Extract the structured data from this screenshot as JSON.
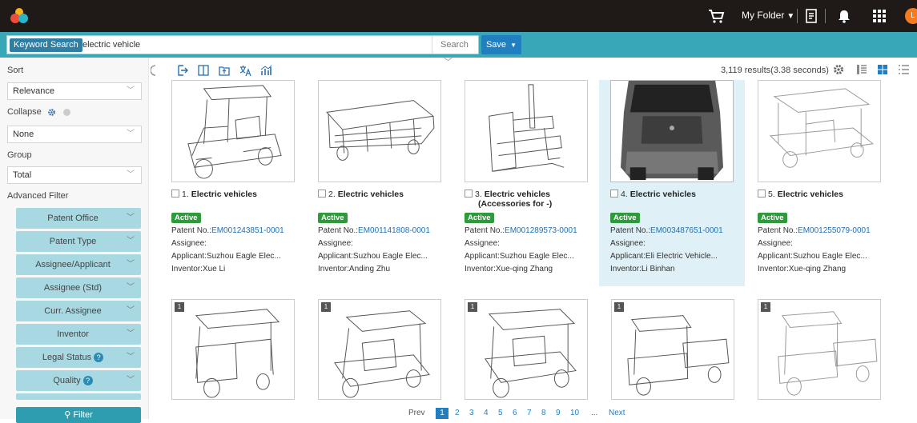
{
  "topbar": {
    "my_folder": "My Folder",
    "avatar_letter": "L"
  },
  "search": {
    "keyword_tag": "Keyword Search",
    "query": "electric vehicle",
    "search_button": "Search",
    "save_button": "Save"
  },
  "sidebar": {
    "sort_label": "Sort",
    "sort_value": "Relevance",
    "collapse_label": "Collapse",
    "collapse_value": "None",
    "group_label": "Group",
    "group_value": "Total",
    "advanced_label": "Advanced Filter",
    "facets": [
      "Patent Office",
      "Patent Type",
      "Assignee/Applicant",
      "Assignee (Std)",
      "Curr. Assignee",
      "Inventor",
      "Legal Status",
      "Quality"
    ],
    "filter_button": "Filter"
  },
  "toolbar": {
    "results_text": "3,119 results(3.38 seconds)"
  },
  "cards": [
    {
      "num": "1.",
      "title": "Electric vehicles",
      "status": "Active",
      "patent_label": "Patent No.:",
      "patent_no": "EM001243851-0001",
      "assignee": "Assignee:",
      "applicant": "Applicant:Suzhou Eagle Elec...",
      "inventor": "Inventor:Xue Li"
    },
    {
      "num": "2.",
      "title": "Electric vehicles",
      "status": "Active",
      "patent_label": "Patent No.:",
      "patent_no": "EM001141808-0001",
      "assignee": "Assignee:",
      "applicant": "Applicant:Suzhou Eagle Elec...",
      "inventor": "Inventor:Anding Zhu"
    },
    {
      "num": "3.",
      "title": "Electric vehicles",
      "title2": "(Accessories for -)",
      "status": "Active",
      "patent_label": "Patent No.:",
      "patent_no": "EM001289573-0001",
      "assignee": "Assignee:",
      "applicant": "Applicant:Suzhou Eagle Elec...",
      "inventor": "Inventor:Xue-qing Zhang"
    },
    {
      "num": "4.",
      "title": "Electric vehicles",
      "status": "Active",
      "patent_label": "Patent No.:",
      "patent_no": "EM003487651-0001",
      "assignee": "Assignee:",
      "applicant": "Applicant:Eli Electric Vehicle...",
      "inventor": "Inventor:Li Binhan"
    },
    {
      "num": "5.",
      "title": "Electric vehicles",
      "status": "Active",
      "patent_label": "Patent No.:",
      "patent_no": "EM001255079-0001",
      "assignee": "Assignee:",
      "applicant": "Applicant:Suzhou Eagle Elec...",
      "inventor": "Inventor:Xue-qing Zhang"
    }
  ],
  "row2_tags": [
    "1",
    "1",
    "1",
    "1",
    "1"
  ],
  "pagination": {
    "prev": "Prev",
    "pages": [
      "1",
      "2",
      "3",
      "4",
      "5",
      "6",
      "7",
      "8",
      "9",
      "10"
    ],
    "ellipsis": "...",
    "next": "Next",
    "current": "1"
  },
  "colors": {
    "topbar": "#1f1a17",
    "searchbar": "#38a7b8",
    "facet": "#a8d9e2",
    "active_badge": "#2e9a3b",
    "link": "#1d6fb8",
    "highlight_card": "#dff1f6"
  }
}
